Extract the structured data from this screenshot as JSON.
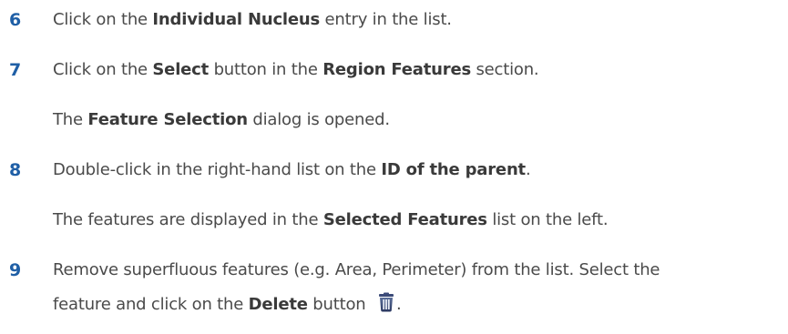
{
  "steps": [
    {
      "num": "6",
      "parts": [
        "Click on the ",
        "Individual Nucleus",
        " entry in the list."
      ]
    },
    {
      "num": "7",
      "parts": [
        "Click on the ",
        "Select",
        " button in the ",
        "Region Features",
        " section."
      ],
      "result": [
        "The ",
        "Feature Selection",
        " dialog is opened."
      ]
    },
    {
      "num": "8",
      "parts": [
        "Double-click in the right-hand list on the ",
        "ID of the parent",
        "."
      ],
      "result": [
        "The features are displayed in the ",
        "Selected Features",
        " list on the left."
      ]
    },
    {
      "num": "9",
      "line1": "Remove superfluous features (e.g. Area, Perimeter) from the list. Select the",
      "line2": [
        "feature and click on the ",
        "Delete",
        " button ",
        "."
      ],
      "icon": "trash-can-icon"
    }
  ],
  "colors": {
    "step_number": "#1f5fa6",
    "body_text": "#4a4a4a"
  }
}
